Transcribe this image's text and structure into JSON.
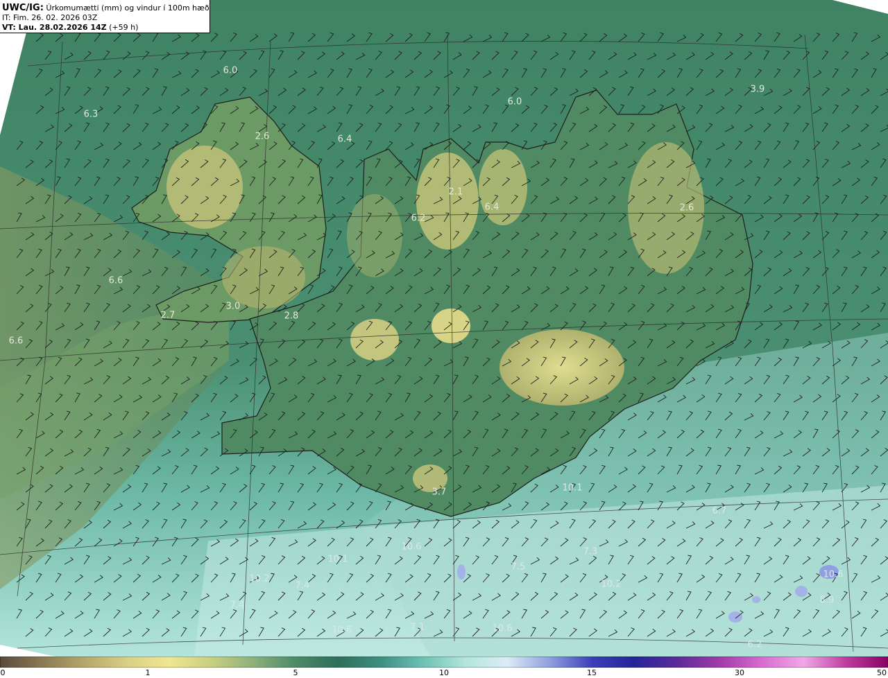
{
  "header": {
    "product": "UWC/IG:",
    "title_rest": " Úrkomumætti (mm) og vindur í 100m hæð",
    "issue_time": "IT: Fim. 26. 02. 2026 03Z",
    "valid_label": "VT: Lau. 28.02.2026 14Z",
    "valid_offset": " (+59 h)"
  },
  "map_labels": [
    "6.0",
    "6.3",
    "2.6",
    "6.4",
    "6.0",
    "3.9",
    "2.1",
    "6.4",
    "6.2",
    "2.6",
    "6.6",
    "3.0",
    "2.8",
    "2.7",
    "6.6",
    "3.7",
    "10.1",
    "6.7",
    "10.6",
    "7.3",
    "10.1",
    "10.2",
    "7.4",
    "7.5",
    "10.2",
    "7.4",
    "10.6",
    "7.1",
    "10.6",
    "10.6",
    "8.9",
    "6.2"
  ],
  "colorbar": {
    "tick_labels": [
      "0",
      "1",
      "5",
      "10",
      "15",
      "30",
      "50"
    ],
    "colors": [
      "#5b4a3a",
      "#8a7a55",
      "#b6a66a",
      "#d9cf86",
      "#f0e690",
      "#c8cf80",
      "#8cb07a",
      "#4c8a68",
      "#2f6e5a",
      "#3e8f82",
      "#6cc1b2",
      "#b3e5dc",
      "#dcecf6",
      "#8f9fe0",
      "#3b3fb8",
      "#24249a",
      "#5a2a9a",
      "#a23aa8",
      "#d86ad0",
      "#f0a8e6",
      "#c03ea0",
      "#880066"
    ]
  },
  "legend_colors": {
    "ocean_main": "#4f9a82",
    "ocean_light": "#b3e5dc",
    "land_low": "#3e7d5d",
    "land_high": "#d9cf86"
  }
}
